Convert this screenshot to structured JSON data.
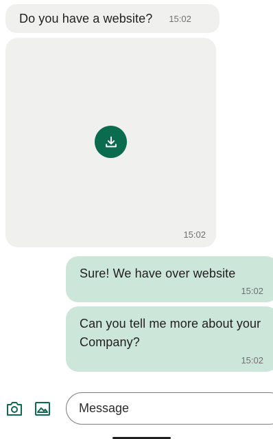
{
  "messages": [
    {
      "direction": "incoming",
      "type": "text",
      "text": "Do you have a website?",
      "time": "15:02"
    },
    {
      "direction": "incoming",
      "type": "media",
      "time": "15:02",
      "action_icon": "download-icon"
    },
    {
      "direction": "outgoing",
      "type": "text",
      "text": "Sure! We have over website",
      "time": "15:02"
    },
    {
      "direction": "outgoing",
      "type": "text",
      "text": "Can you tell me more about your Company?",
      "time": "15:02"
    }
  ],
  "composer": {
    "placeholder": "Message",
    "icons": [
      "camera-icon",
      "gallery-icon"
    ]
  },
  "colors": {
    "incoming_bubble": "#f0f1ef",
    "outgoing_bubble": "#cde6da",
    "accent": "#0b6b4e"
  }
}
